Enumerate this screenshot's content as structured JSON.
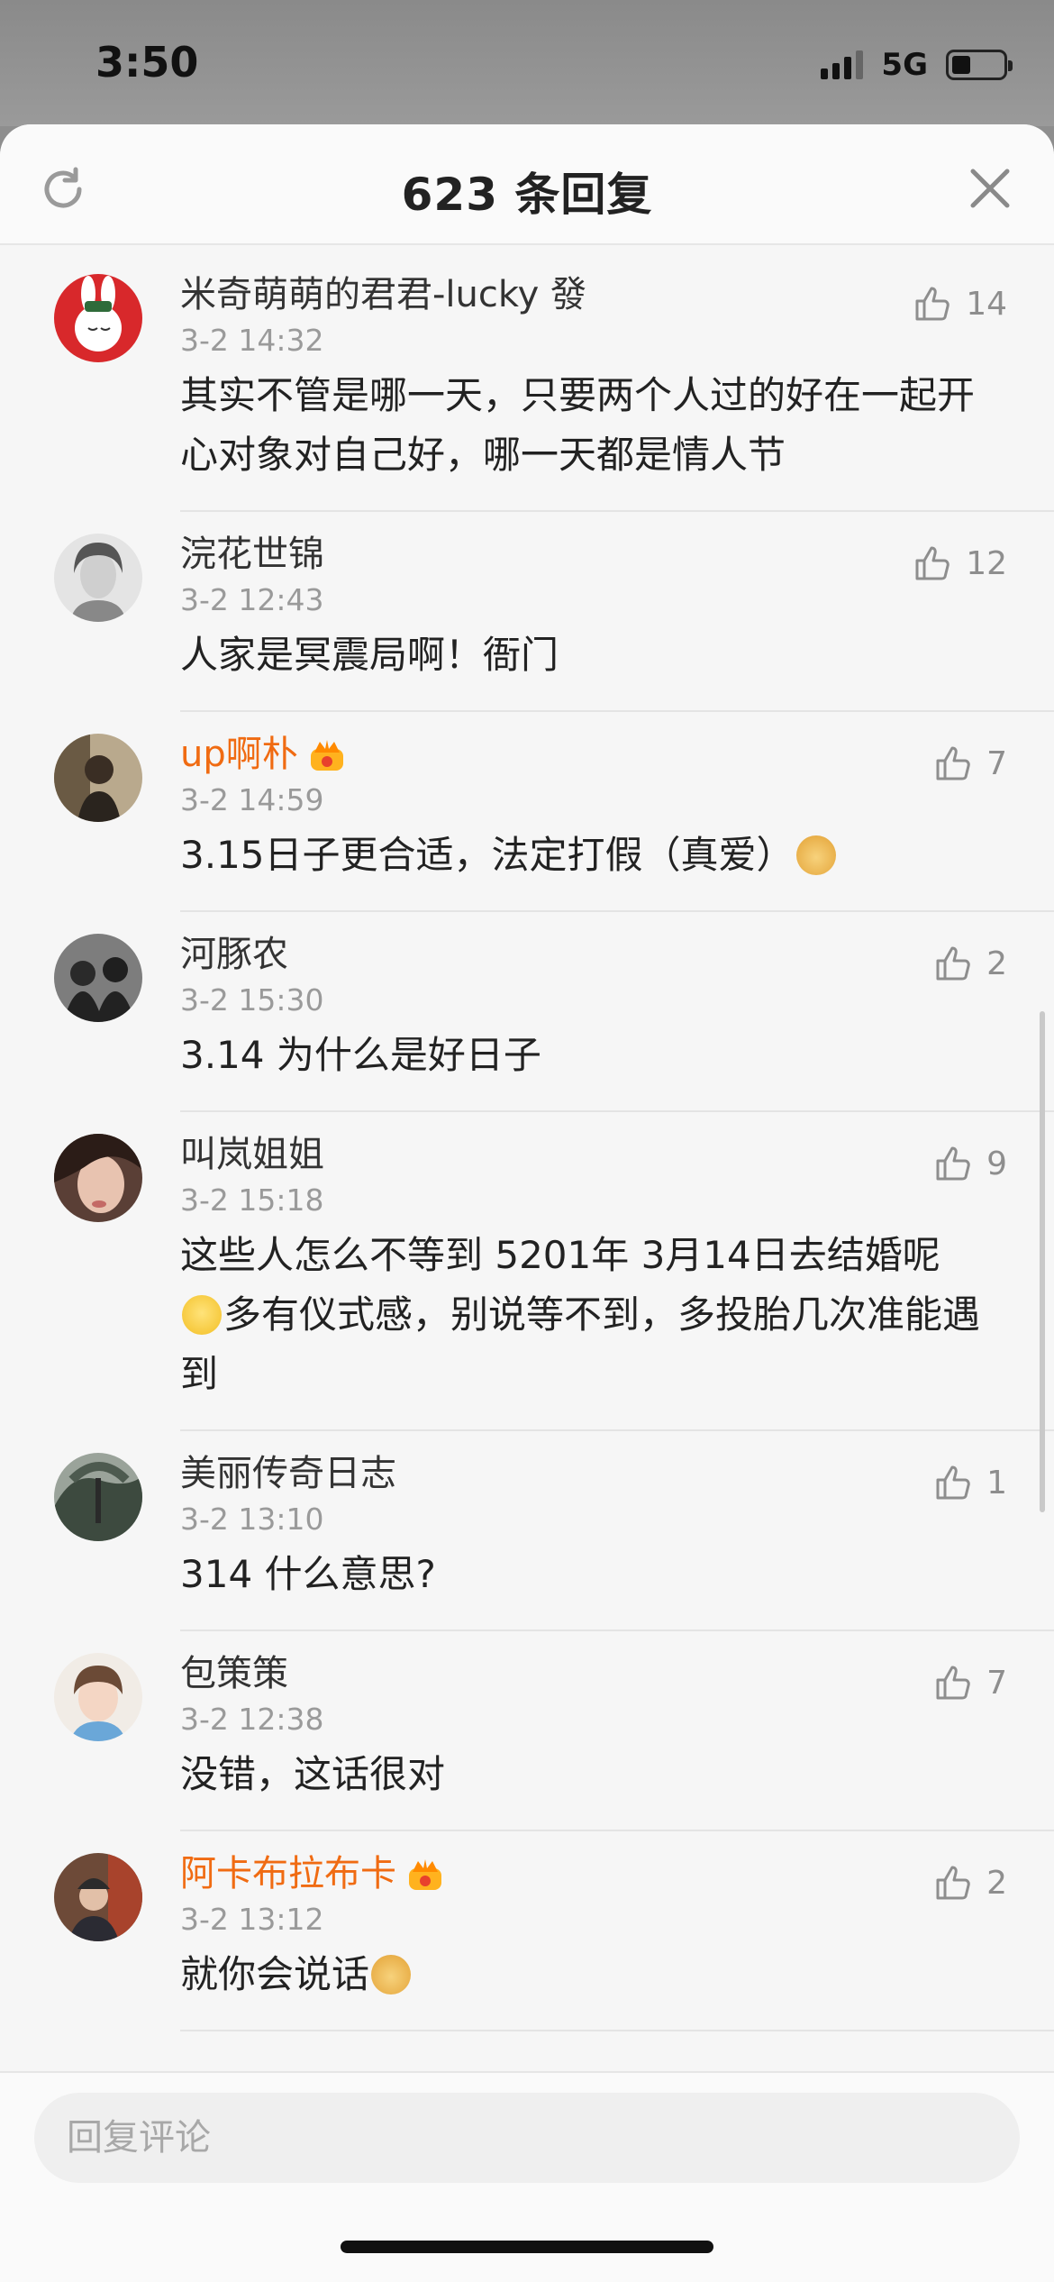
{
  "status_bar": {
    "time": "3:50",
    "network": "5G"
  },
  "header": {
    "title": "623 条回复"
  },
  "comments": [
    {
      "name": "米奇萌萌的君君-lucky 發",
      "time": "3-2 14:32",
      "text": "其实不管是哪一天，只要两个人过的好在一起开心对象对自己好，哪一天都是情人节",
      "likes": "14",
      "vip": false
    },
    {
      "name": "浣花世锦",
      "time": "3-2 12:43",
      "text": "人家是冥震局啊！衙门",
      "likes": "12",
      "vip": false
    },
    {
      "name": "up啊朴",
      "time": "3-2 14:59",
      "text": "3.15日子更合适，法定打假（真爱）",
      "likes": "7",
      "vip": true
    },
    {
      "name": "河豚农",
      "time": "3-2 15:30",
      "text": "3.14 为什么是好日子",
      "likes": "2",
      "vip": false
    },
    {
      "name": "叫岚姐姐",
      "time": "3-2 15:18",
      "text_before": "这些人怎么不等到 5201年 3月14日去结婚呢",
      "text_after": "多有仪式感，别说等不到，多投胎几次准能遇到",
      "likes": "9",
      "vip": false
    },
    {
      "name": "美丽传奇日志",
      "time": "3-2 13:10",
      "text": "314 什么意思?",
      "likes": "1",
      "vip": false
    },
    {
      "name": "包策策",
      "time": "3-2 12:38",
      "text": "没错，这话很对",
      "likes": "7",
      "vip": false
    },
    {
      "name": "阿卡布拉布卡",
      "time": "3-2 13:12",
      "text": "就你会说话",
      "likes": "2",
      "vip": true
    }
  ],
  "reply_box": {
    "placeholder": "回复评论"
  },
  "icons": {
    "refresh": "refresh-icon",
    "close": "close-icon",
    "like": "thumbs-up-icon",
    "vip_badge": "crown-badge-icon",
    "doge_emoji": "doge-emoji-icon",
    "smile_emoji": "smile-emoji-icon"
  },
  "colors": {
    "vip_name": "#f06b12",
    "meta_gray": "#9a9a9a",
    "sheet_bg": "#f6f6f6"
  }
}
